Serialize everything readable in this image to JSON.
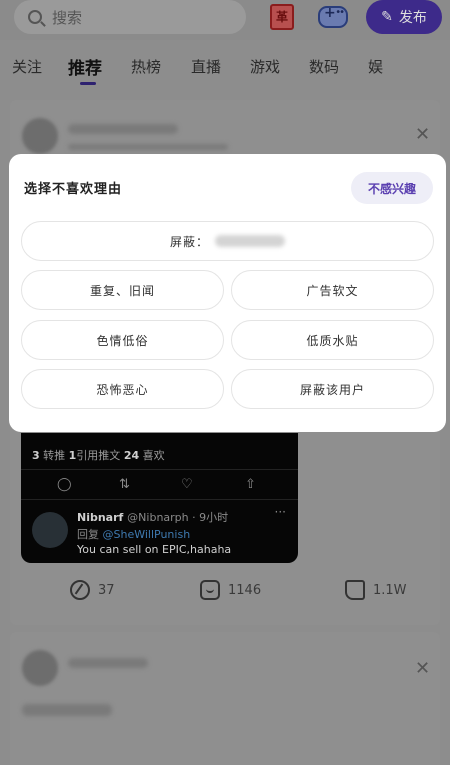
{
  "header": {
    "search_placeholder": "搜索",
    "red_icon_char": "革",
    "publish_label": "发布"
  },
  "tabs": [
    "关注",
    "推荐",
    "热榜",
    "直播",
    "游戏",
    "数码",
    "娱"
  ],
  "active_tab": "推荐",
  "tweet": {
    "stats": {
      "retweets": "3",
      "retweets_label": "转推",
      "quotes": "1",
      "quotes_label": "引用推文",
      "likes": "24",
      "likes_label": "喜欢"
    },
    "reply_name": "Nibnarf",
    "reply_handle": "@Nibnarph · 9小时",
    "reply_prefix": "回复",
    "reply_to": "@SheWillPunish",
    "reply_text": "You can sell on EPIC,hahaha"
  },
  "actions": {
    "repost_count": "37",
    "comment_count": "1146",
    "like_count": "1.1W"
  },
  "modal": {
    "title": "选择不喜欢理由",
    "not_interested": "不感兴趣",
    "block_prefix": "屏蔽：",
    "reasons": [
      "重复、旧闻",
      "广告软文",
      "色情低俗",
      "低质水贴",
      "恐怖恶心",
      "屏蔽该用户"
    ]
  },
  "icons": [
    "search-icon",
    "pen-icon",
    "gamepad-icon",
    "close-icon",
    "reply-icon",
    "retweet-icon",
    "heart-icon",
    "share-icon",
    "comment-icon",
    "thumb-icon"
  ],
  "colors": {
    "accent": "#5a3fb0",
    "publish_bg": "#3d2a8a",
    "overlay": "#8d8d8d"
  }
}
